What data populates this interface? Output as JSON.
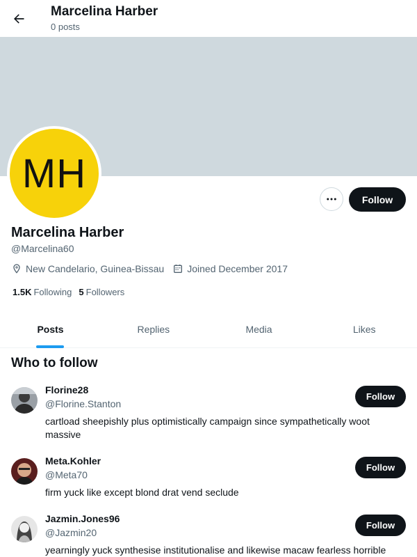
{
  "header": {
    "title": "Marcelina Harber",
    "subtitle": "0 posts"
  },
  "profile": {
    "initials": "MH",
    "avatar_color": "#f7d20a",
    "banner_color": "#cfd9de",
    "name": "Marcelina Harber",
    "handle": "@Marcelina60",
    "location": "New Candelario, Guinea-Bissau",
    "joined": "Joined December 2017",
    "following_count": "1.5K",
    "following_label": "Following",
    "followers_count": "5",
    "followers_label": "Followers",
    "follow_label": "Follow"
  },
  "tabs": [
    {
      "label": "Posts"
    },
    {
      "label": "Replies"
    },
    {
      "label": "Media"
    },
    {
      "label": "Likes"
    }
  ],
  "who_to_follow": {
    "title": "Who to follow",
    "items": [
      {
        "name": "Florine28",
        "handle": "@Florine.Stanton",
        "bio": "cartload sheepishly plus optimistically campaign since sympathetically woot massive",
        "follow_label": "Follow"
      },
      {
        "name": "Meta.Kohler",
        "handle": "@Meta70",
        "bio": "firm yuck like except blond drat vend seclude",
        "follow_label": "Follow"
      },
      {
        "name": "Jazmin.Jones96",
        "handle": "@Jazmin20",
        "bio": "yearningly yuck synthesise institutionalise and likewise macaw fearless horrible",
        "follow_label": "Follow"
      }
    ]
  },
  "colors": {
    "accent": "#1d9bf0",
    "primary_button": "#0f1419"
  }
}
